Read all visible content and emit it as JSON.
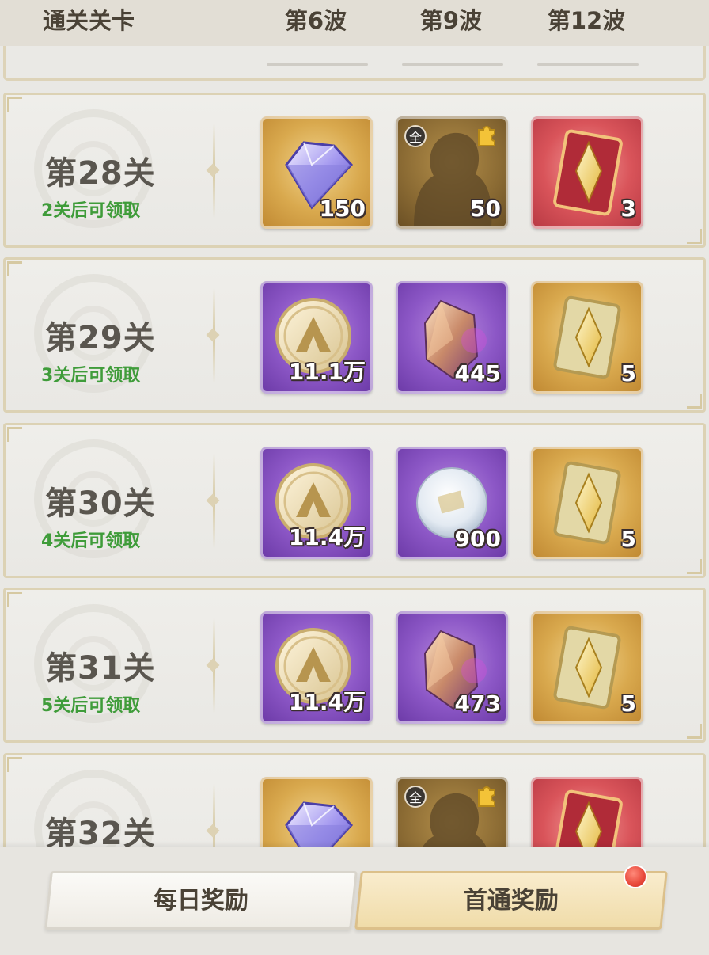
{
  "header": {
    "stage_col": "通关关卡",
    "wave6": "第6波",
    "wave9": "第9波",
    "wave12": "第12波"
  },
  "rows": [
    {
      "stage": "第28关",
      "hint": "2关后可领取",
      "rewards": [
        {
          "icon": "diamond-gem-icon",
          "quality": "gold",
          "qty": "150"
        },
        {
          "icon": "character-shard-icon",
          "quality": "brown",
          "qty": "50",
          "badge": "全"
        },
        {
          "icon": "red-crystal-card-icon",
          "quality": "red",
          "qty": "3"
        }
      ]
    },
    {
      "stage": "第29关",
      "hint": "3关后可领取",
      "rewards": [
        {
          "icon": "gold-coin-icon",
          "quality": "purple",
          "qty": "11.1万"
        },
        {
          "icon": "amber-crystal-icon",
          "quality": "purple",
          "qty": "445"
        },
        {
          "icon": "gold-crystal-card-icon",
          "quality": "gold",
          "qty": "5"
        }
      ]
    },
    {
      "stage": "第30关",
      "hint": "4关后可领取",
      "rewards": [
        {
          "icon": "gold-coin-icon",
          "quality": "purple",
          "qty": "11.4万"
        },
        {
          "icon": "pearl-orb-icon",
          "quality": "purple",
          "qty": "900"
        },
        {
          "icon": "gold-crystal-card-icon",
          "quality": "gold",
          "qty": "5"
        }
      ]
    },
    {
      "stage": "第31关",
      "hint": "5关后可领取",
      "rewards": [
        {
          "icon": "gold-coin-icon",
          "quality": "purple",
          "qty": "11.4万"
        },
        {
          "icon": "amber-crystal-icon",
          "quality": "purple",
          "qty": "473"
        },
        {
          "icon": "gold-crystal-card-icon",
          "quality": "gold",
          "qty": "5"
        }
      ]
    },
    {
      "stage": "第32关",
      "hint": "",
      "rewards": [
        {
          "icon": "diamond-gem-icon",
          "quality": "gold",
          "qty": ""
        },
        {
          "icon": "character-shard-icon",
          "quality": "brown",
          "qty": "",
          "badge": "全"
        },
        {
          "icon": "red-crystal-card-icon",
          "quality": "red",
          "qty": ""
        }
      ]
    }
  ],
  "tabs": {
    "daily": "每日奖励",
    "first_clear": "首通奖励"
  },
  "colors": {
    "hint_green": "#3f9c3a",
    "gold_quality": "#d9a94e",
    "purple_quality": "#8c57c6",
    "red_quality": "#d9545a",
    "notification_red": "#e8483a"
  }
}
